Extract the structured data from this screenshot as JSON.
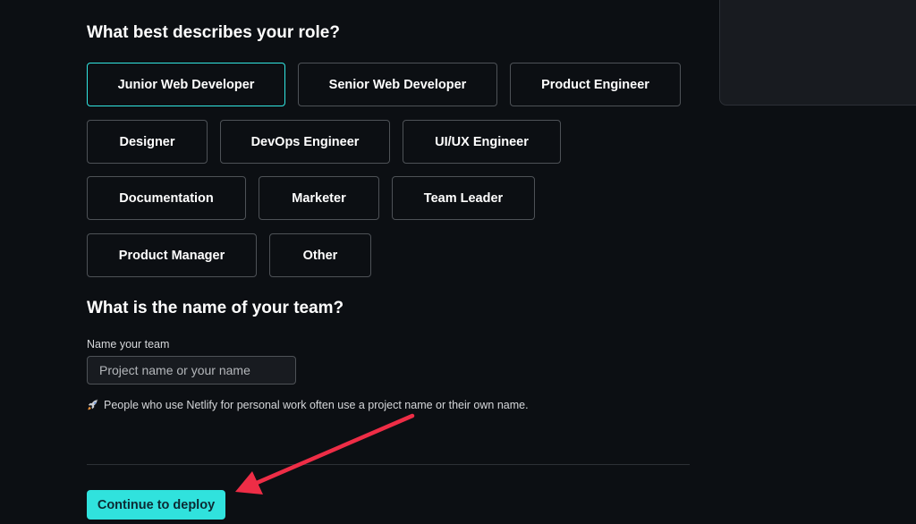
{
  "role_section": {
    "heading": "What best describes your role?",
    "selected": "Junior Web Developer",
    "options": [
      "Junior Web Developer",
      "Senior Web Developer",
      "Product Engineer",
      "Designer",
      "DevOps Engineer",
      "UI/UX Engineer",
      "Documentation",
      "Marketer",
      "Team Leader",
      "Product Manager",
      "Other"
    ]
  },
  "team_section": {
    "heading": "What is the name of your team?",
    "field_label": "Name your team",
    "placeholder": "Project name or your name",
    "value": "",
    "hint": "People who use Netlify for personal work often use a project name or their own name."
  },
  "cta": {
    "label": "Continue to deploy"
  },
  "colors": {
    "background": "#0c0f13",
    "accent": "#30e2dd",
    "annotation_arrow": "#ee2d46"
  },
  "icons": {
    "hint": "rocket-icon",
    "annotation": "arrow-annotation"
  }
}
